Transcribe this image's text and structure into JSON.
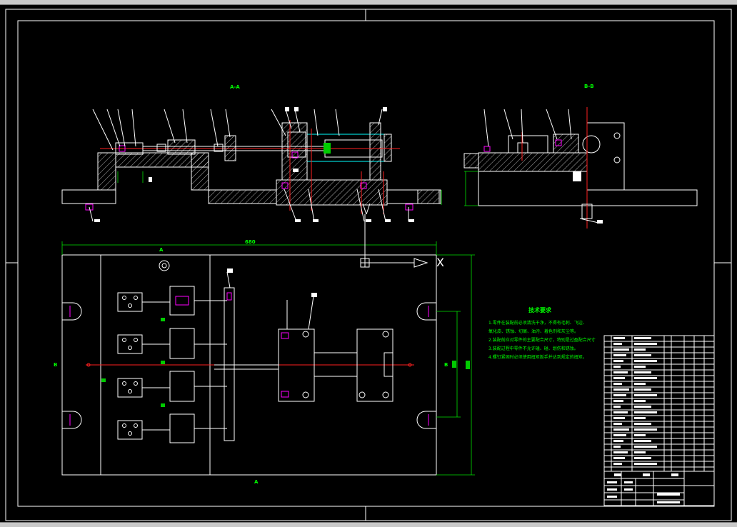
{
  "window": {
    "background": "#000000",
    "chrome_color": "#c9c9c9"
  },
  "drawing": {
    "view_labels": [
      "A-A",
      "B-B"
    ],
    "overall_dimension": "680",
    "section_marks": [
      "A",
      "A",
      "B",
      "B"
    ],
    "arrow_label": "X",
    "technical_requirements": {
      "title": "技术要求",
      "lines": [
        "1.零件在装配前必须清洗干净，不得有毛刺、飞边、",
        "氧化皮、锈蚀、切屑、油污、着色剂和灰尘等。",
        "2.装配前应对零件的主要配合尺寸，特别是过盈配合尺寸",
        "3.装配过程中零件不允许磕、碰、划伤和锈蚀。",
        "4.螺钉紧固时必须使用扭矩扳手并达到规定的扭矩。"
      ]
    },
    "colors": {
      "outline": "#ffffff",
      "dimension": "#00e000",
      "centerline": "#ff2020",
      "cylinder": "#00ffff",
      "fastener": "#ff00ff",
      "text": "#00ff00"
    }
  }
}
